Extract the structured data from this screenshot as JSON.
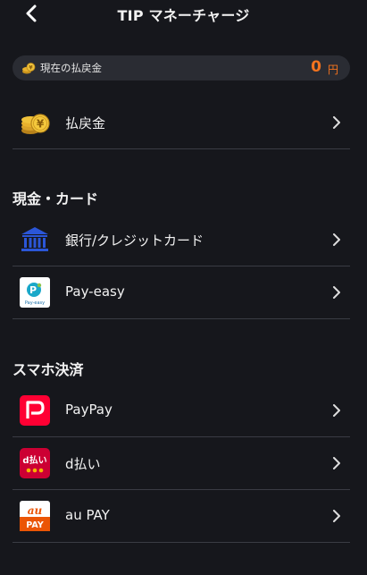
{
  "header": {
    "title": "TIP マネーチャージ"
  },
  "balance": {
    "label": "現在の払戻金",
    "amount": "0",
    "unit": "円"
  },
  "refund": {
    "label": "払戻金"
  },
  "sections": {
    "cash": {
      "title": "現金・カード"
    },
    "mobile": {
      "title": "スマホ決済"
    }
  },
  "items": {
    "bank": {
      "label": "銀行/クレジットカード"
    },
    "payeasy": {
      "label": "Pay-easy",
      "icon_text": "Pay-easy"
    },
    "paypay": {
      "label": "PayPay"
    },
    "dpay": {
      "label": "d払い",
      "icon_text": "d払い"
    },
    "aupay": {
      "label": "au PAY",
      "icon_text_top": "au",
      "icon_text_bottom": "PAY"
    }
  },
  "colors": {
    "background": "#16171c",
    "accent_orange": "#f4731e",
    "paypay_red": "#ff0033",
    "dpay_red": "#cc0033",
    "aupay_orange": "#eb5505"
  },
  "icons": [
    "back-chevron",
    "coin-stack-icon",
    "bank-icon",
    "payeasy-icon",
    "paypay-icon",
    "dpay-icon",
    "aupay-icon",
    "chevron-right-icon"
  ]
}
